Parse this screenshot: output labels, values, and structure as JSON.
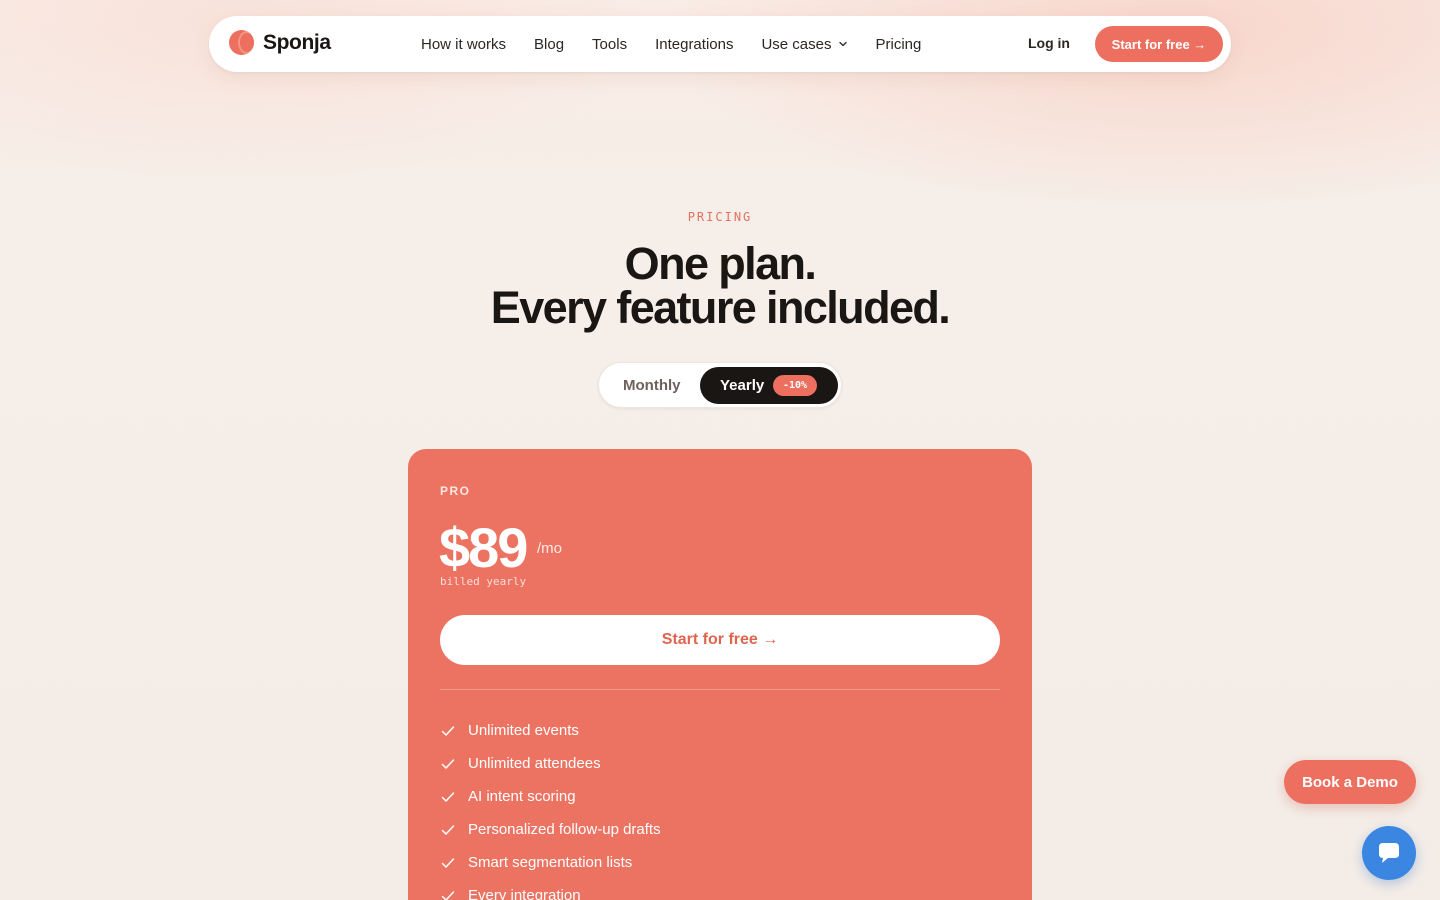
{
  "nav": {
    "brand": "Sponja",
    "links": [
      "How it works",
      "Blog",
      "Tools",
      "Integrations",
      "Use cases",
      "Pricing"
    ],
    "login": "Log in",
    "cta": "Start for free →"
  },
  "hero": {
    "eyebrow": "PRICING",
    "title_line1": "One plan.",
    "title_line2": "Every feature included."
  },
  "billing_toggle": {
    "monthly": "Monthly",
    "yearly": "Yearly",
    "discount_badge": "-10%",
    "selected": "Yearly"
  },
  "plan_card": {
    "name": "PRO",
    "price": "$89",
    "period": "/mo",
    "billing_note": "billed yearly",
    "cta": "Start for free →",
    "features": [
      "Unlimited events",
      "Unlimited attendees",
      "AI intent scoring",
      "Personalized follow-up drafts",
      "Smart segmentation lists",
      "Every integration"
    ]
  },
  "floating": {
    "demo_button": "Book a Demo",
    "chat_icon": "chat-bubble-icon"
  },
  "colors": {
    "accent": "#ec6f5f",
    "card": "#ec7362",
    "dark": "#1a1614",
    "chat": "#3b86e0"
  }
}
